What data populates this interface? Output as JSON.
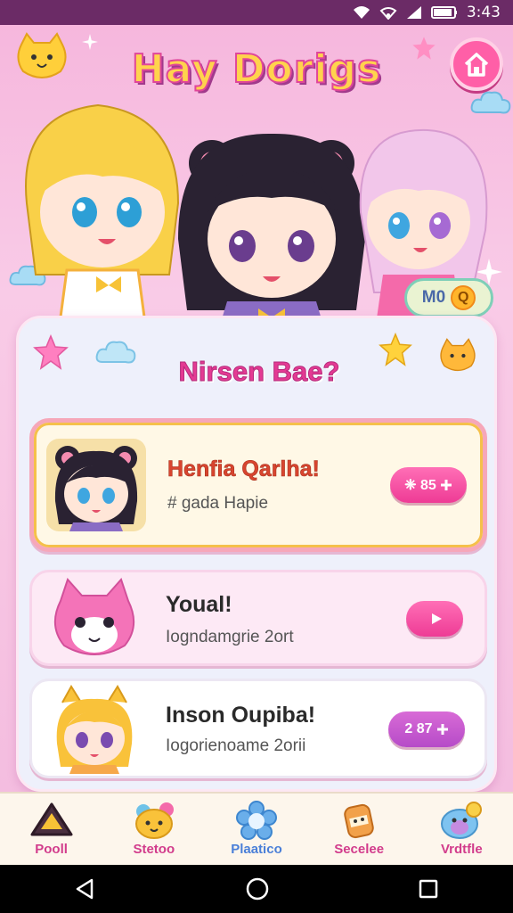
{
  "status_bar": {
    "time": "3:43",
    "icons": [
      "wifi-icon",
      "wifi-alt-icon",
      "signal-icon",
      "battery-icon"
    ]
  },
  "header": {
    "title": "Hay Dorigs",
    "home_icon": "home-icon"
  },
  "currency": {
    "label": "M0",
    "coin_symbol": "Q"
  },
  "panel": {
    "title": "Nirsen Bae?"
  },
  "cards": [
    {
      "title": "Henfia Qarlha!",
      "subtitle": "# gada Hapie",
      "button": "❈ 85",
      "button_icon": "plus-icon"
    },
    {
      "title": "Youal!",
      "subtitle": "Iogndamgrie 2ort",
      "button": "",
      "button_icon": "play-icon"
    },
    {
      "title": "Inson Oupiba!",
      "subtitle": "Iogorienoame 2orii",
      "button": "2 87",
      "button_icon": "plus-icon"
    }
  ],
  "bottom_nav": [
    {
      "label": "Pooll",
      "icon": "triangle-icon",
      "color": "#d23c8c"
    },
    {
      "label": "Stetoo",
      "icon": "bear-face-icon",
      "color": "#d23c8c"
    },
    {
      "label": "Plaatico",
      "icon": "flower-icon",
      "color": "#4a7fd8"
    },
    {
      "label": "Secelee",
      "icon": "jar-icon",
      "color": "#d23c8c"
    },
    {
      "label": "Vrdtfle",
      "icon": "creature-icon",
      "color": "#d23c8c"
    }
  ],
  "colors": {
    "accent_pink": "#ee3b95",
    "accent_purple": "#b64bc8",
    "status_bar": "#6b2b66"
  }
}
